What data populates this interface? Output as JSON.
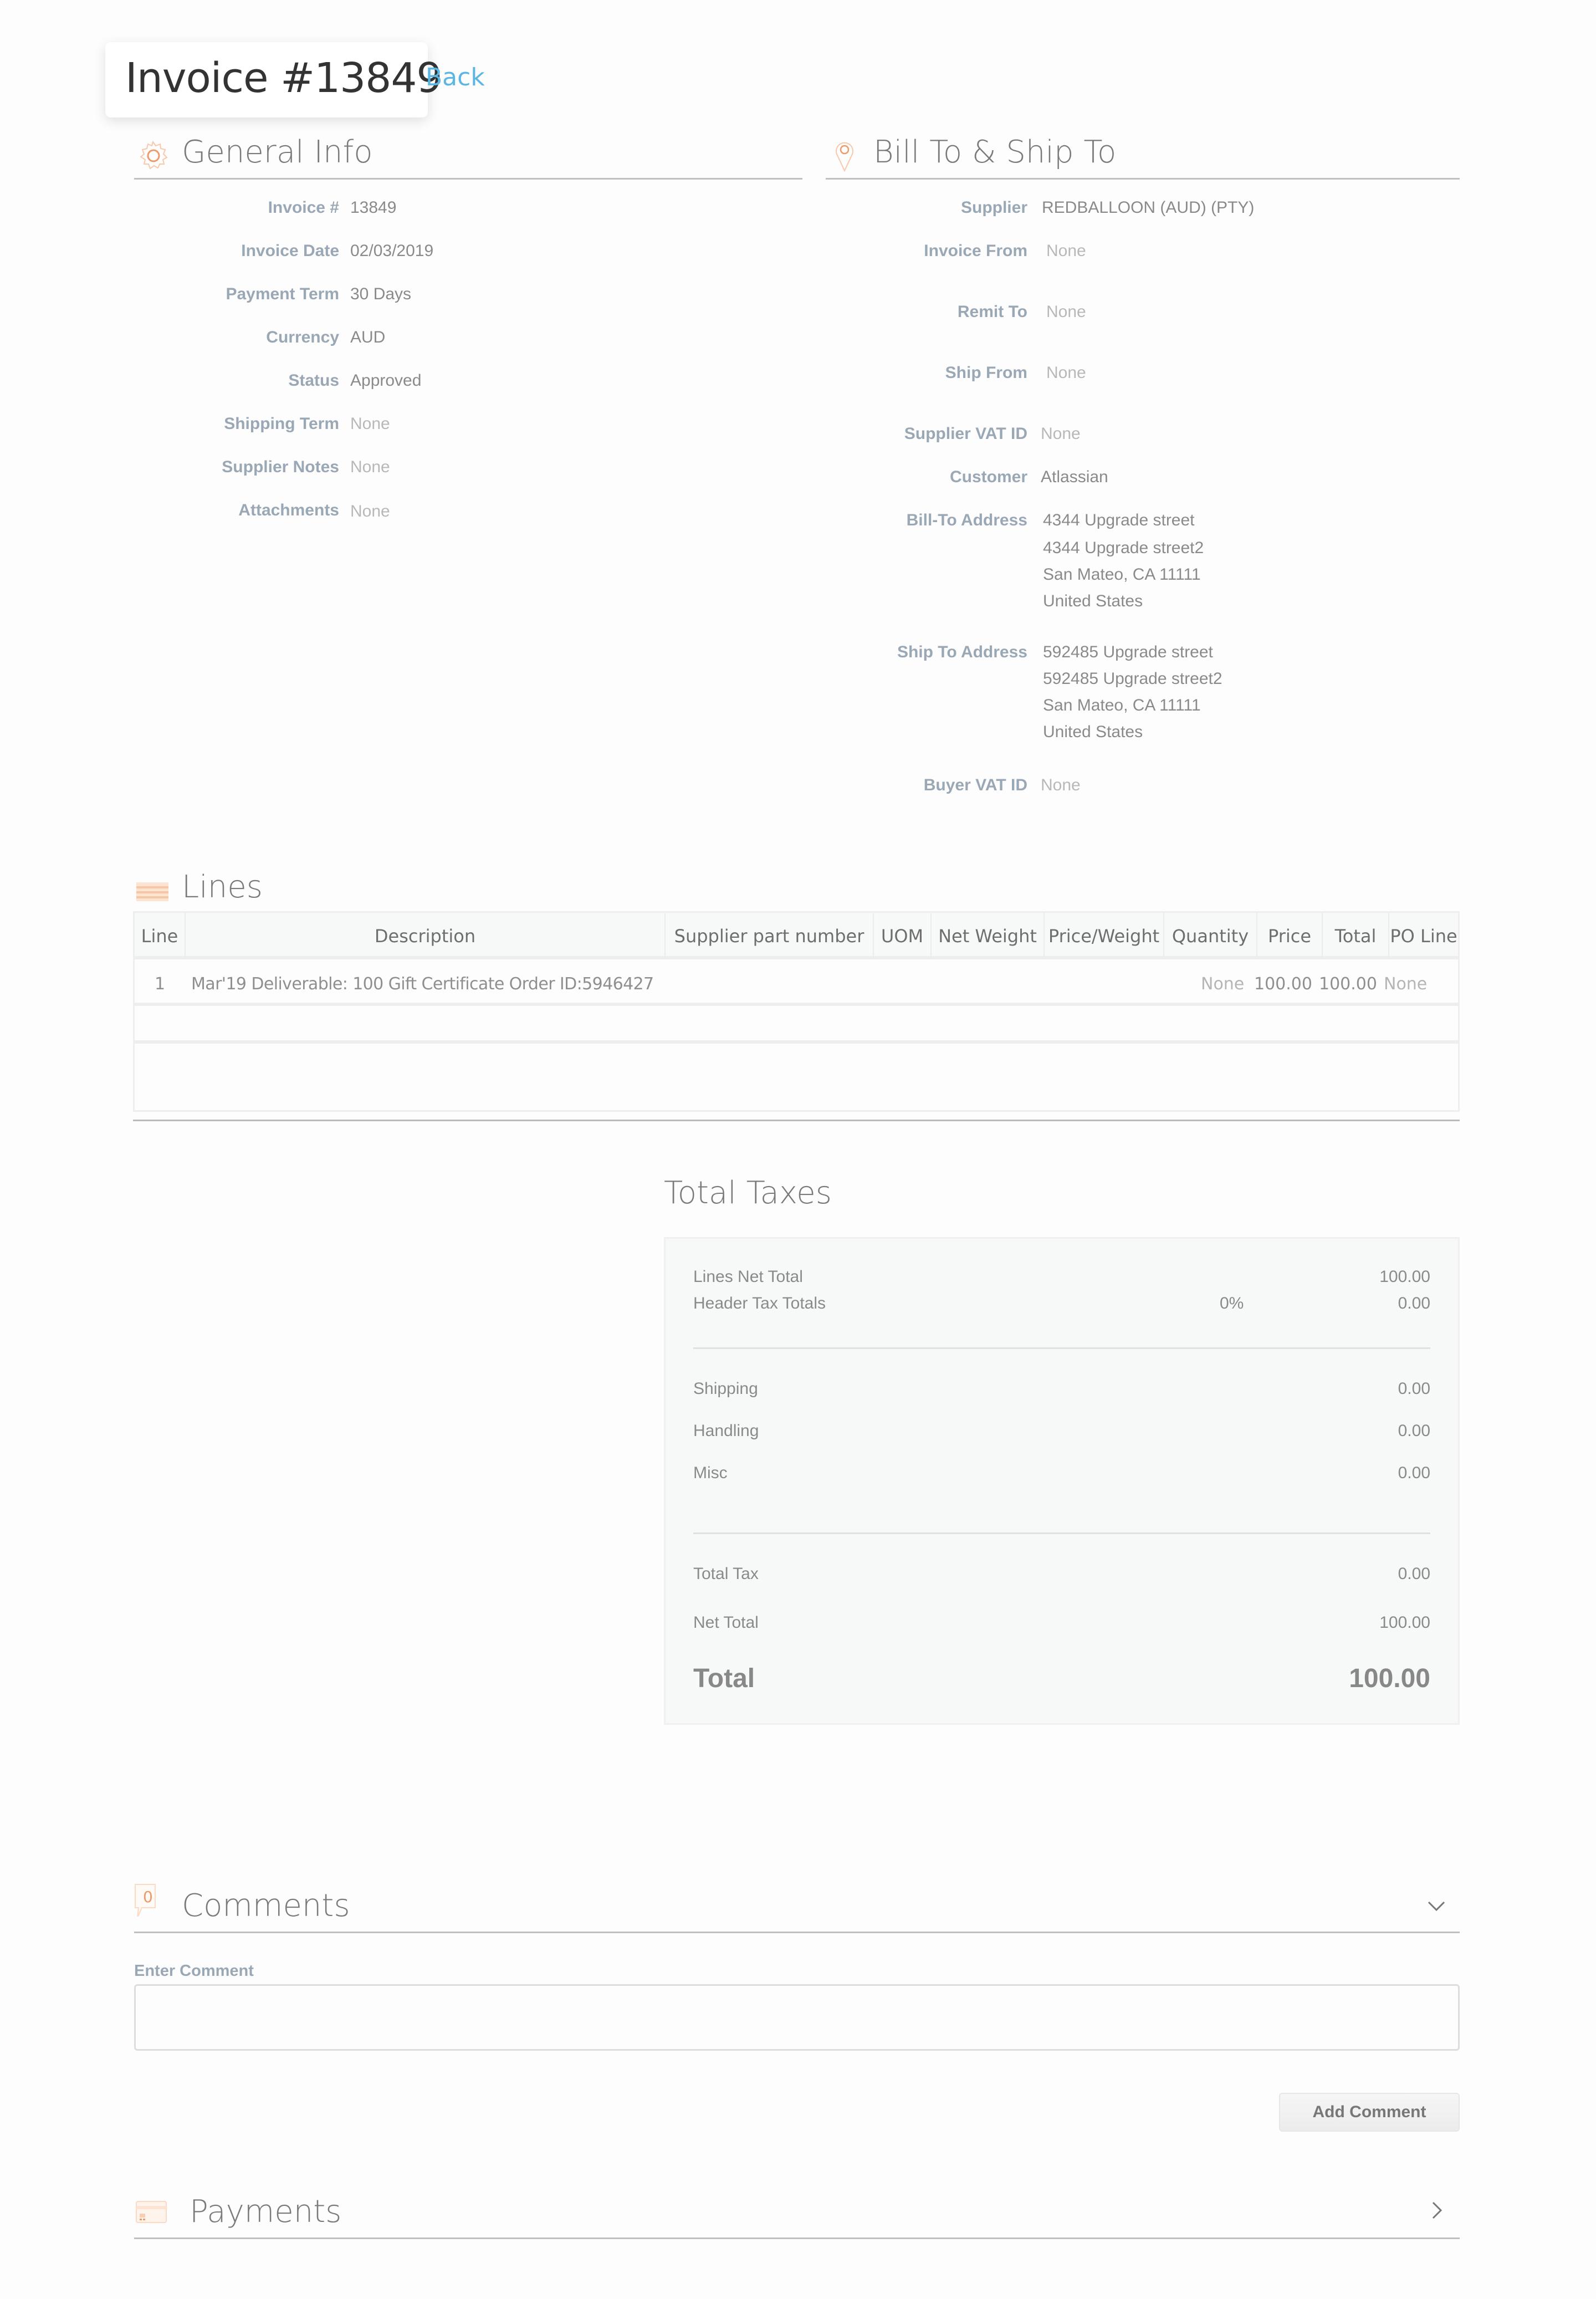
{
  "header": {
    "title": "Invoice #13849",
    "back_label": "Back"
  },
  "general_info": {
    "title": "General Info",
    "icon": "gear-icon",
    "fields": [
      {
        "label": "Invoice #",
        "value": "13849"
      },
      {
        "label": "Invoice Date",
        "value": "02/03/2019"
      },
      {
        "label": "Payment Term",
        "value": "30 Days"
      },
      {
        "label": "Currency",
        "value": "AUD"
      },
      {
        "label": "Status",
        "value": "Approved"
      },
      {
        "label": "Shipping Term",
        "value": "None"
      },
      {
        "label": "Supplier Notes",
        "value": "None"
      },
      {
        "label": "Attachments",
        "value": "None"
      }
    ]
  },
  "bill_ship": {
    "title": "Bill To & Ship To",
    "icon": "map-pin-icon",
    "supplier": {
      "label": "Supplier",
      "value": "REDBALLOON (AUD) (PTY)"
    },
    "invoice_from": {
      "label": "Invoice From",
      "value": "None"
    },
    "remit_to": {
      "label": "Remit To",
      "value": "None"
    },
    "ship_from": {
      "label": "Ship From",
      "value": "None"
    },
    "supplier_vat": {
      "label": "Supplier VAT ID",
      "value": "None"
    },
    "customer": {
      "label": "Customer",
      "value": "Atlassian"
    },
    "bill_to_address": {
      "label": "Bill-To Address",
      "lines": [
        "4344 Upgrade street",
        "4344 Upgrade street2",
        "San Mateo, CA 11111",
        "United States"
      ]
    },
    "ship_to_address": {
      "label": "Ship To Address",
      "lines": [
        "592485 Upgrade street",
        "592485 Upgrade street2",
        "San Mateo, CA 11111",
        "United States"
      ]
    },
    "buyer_vat": {
      "label": "Buyer VAT ID",
      "value": "None"
    }
  },
  "lines": {
    "title": "Lines",
    "icon": "list-icon",
    "columns": [
      "Line",
      "Description",
      "Supplier part number",
      "UOM",
      "Net Weight",
      "Price/Weight",
      "Quantity",
      "Price",
      "Total",
      "PO Line"
    ],
    "rows": [
      {
        "line": "1",
        "description": "Mar'19 Deliverable: 100 Gift Certificate Order ID:5946427",
        "supplier_part_number": "",
        "uom": "",
        "net_weight": "",
        "price_weight": "",
        "quantity": "None",
        "price": "100.00",
        "total": "100.00",
        "po_line": "None"
      }
    ]
  },
  "totals": {
    "title": "Total Taxes",
    "lines_net_total": {
      "label": "Lines Net Total",
      "value": "100.00"
    },
    "header_tax_totals": {
      "label": "Header Tax Totals",
      "percent": "0%",
      "value": "0.00"
    },
    "shipping": {
      "label": "Shipping",
      "value": "0.00"
    },
    "handling": {
      "label": "Handling",
      "value": "0.00"
    },
    "misc": {
      "label": "Misc",
      "value": "0.00"
    },
    "total_tax": {
      "label": "Total Tax",
      "value": "0.00"
    },
    "net_total": {
      "label": "Net Total",
      "value": "100.00"
    },
    "total": {
      "label": "Total",
      "value": "100.00"
    }
  },
  "comments": {
    "title": "Comments",
    "count": "0",
    "icon": "comment-bubble-icon",
    "enter_label": "Enter Comment",
    "input_value": "",
    "placeholder": "",
    "add_button": "Add Comment"
  },
  "payments": {
    "title": "Payments",
    "icon": "payment-card-icon"
  },
  "colors": {
    "accent_orange": "#f0a878",
    "link_blue": "#5ab6e2",
    "label_blue_gray": "#9aa8b6",
    "value_gray": "#8a8a8a"
  }
}
